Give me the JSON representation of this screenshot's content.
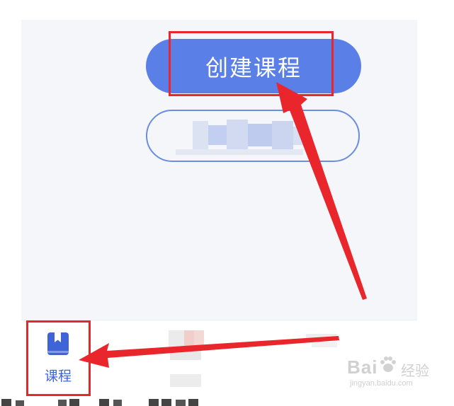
{
  "buttons": {
    "create_course_label": "创建课程"
  },
  "tabbar": {
    "course_label": "课程"
  },
  "watermark": {
    "brand": "Bai",
    "brand_suffix": "经验",
    "url": "jingyan.baidu.com"
  },
  "colors": {
    "primary_button": "#5a7fe6",
    "secondary_border": "#6b8de0",
    "tab_active": "#3f64d8",
    "annotation_red": "#e8262b",
    "screen_background": "#f4f6fa"
  },
  "icons": {
    "course_tab": "book-icon",
    "watermark": "paw-icon"
  }
}
